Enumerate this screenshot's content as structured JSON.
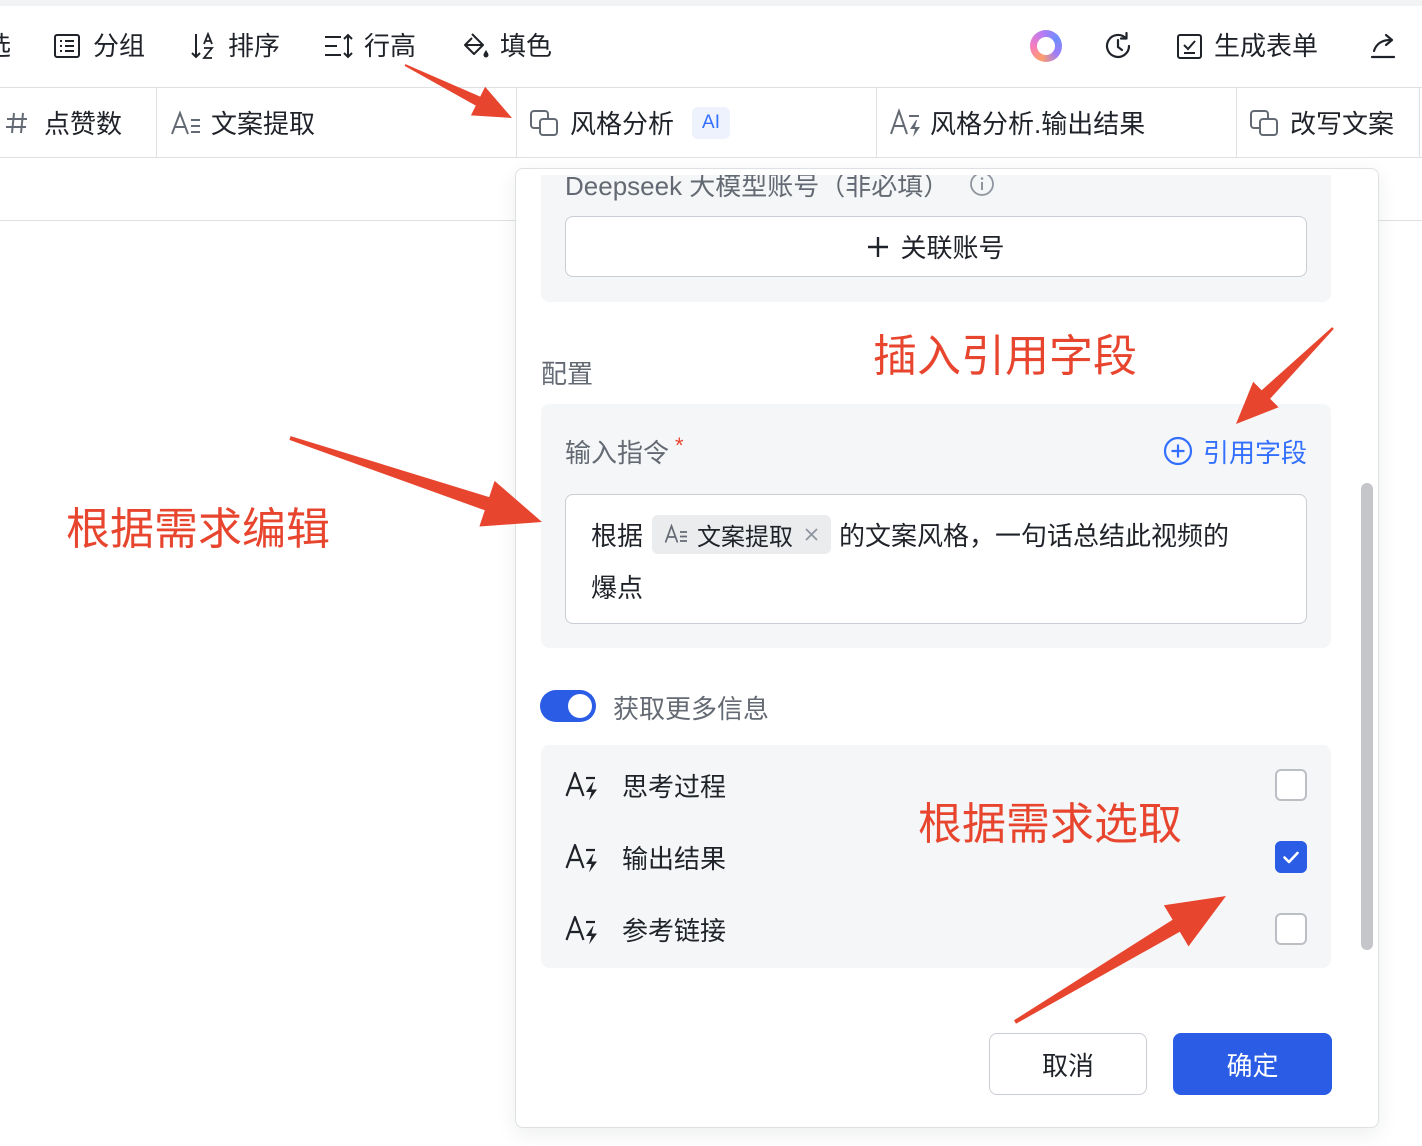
{
  "toolbar": {
    "cut_off_label": "选",
    "group_label": "分组",
    "sort_label": "排序",
    "row_height_label": "行高",
    "fill_label": "填色",
    "generate_form_label": "生成表单",
    "icons": {
      "group": "group-icon",
      "sort": "sort-icon",
      "row_height": "row-height-icon",
      "fill": "fill-color-icon",
      "ai_assistant": "ai-ring-icon",
      "history": "history-icon",
      "generate_form": "form-icon",
      "share": "share-icon"
    }
  },
  "columns": [
    {
      "label": "点赞数",
      "icon": "number-field-icon"
    },
    {
      "label": "文案提取",
      "icon": "text-field-icon"
    },
    {
      "label": "风格分析",
      "icon": "ai-field-icon",
      "badge": "AI"
    },
    {
      "label": "风格分析.输出结果",
      "icon": "ai-text-field-icon"
    },
    {
      "label": "改写文案",
      "icon": "ai-field-icon"
    }
  ],
  "modal": {
    "account": {
      "label": "Deepseek 大模型账号（非必填）",
      "link_button": "关联账号"
    },
    "config_label": "配置",
    "instruction": {
      "label": "输入指令",
      "required_mark": "*",
      "reference_button": "引用字段",
      "text_before_tag": "根据",
      "tag": "文案提取",
      "text_after_tag": "的文案风格，一句话总结此视频的",
      "text_wrapped": "爆点"
    },
    "more_info": {
      "label": "获取更多信息",
      "enabled": true
    },
    "outputs": [
      {
        "label": "思考过程",
        "checked": false
      },
      {
        "label": "输出结果",
        "checked": true
      },
      {
        "label": "参考链接",
        "checked": false
      }
    ],
    "cancel_button": "取消",
    "confirm_button": "确定"
  },
  "annotations": {
    "insert_reference": "插入引用字段",
    "edit_as_needed": "根据需求编辑",
    "select_as_needed": "根据需求选取"
  },
  "colors": {
    "primary": "#2b5ce6",
    "link": "#3370ff",
    "annotation_red": "#e8452f",
    "text": "#1f2329",
    "secondary_text": "#646a73",
    "panel": "#f5f6f7",
    "border": "#dee0e3"
  }
}
